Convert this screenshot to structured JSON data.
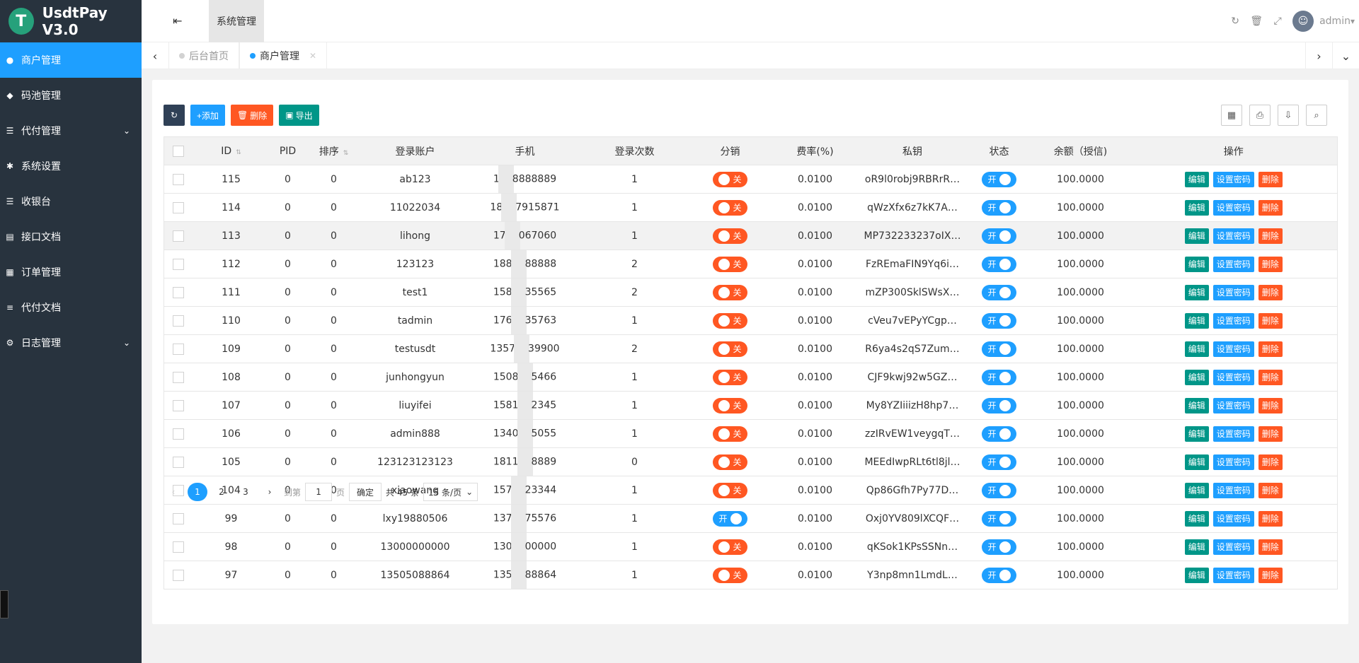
{
  "app": {
    "logo_glyph": "T",
    "title": "UsdtPay V3.0"
  },
  "sidebar": {
    "items": [
      {
        "label": "商户管理",
        "icon": "user-icon",
        "glyph": "●",
        "active": true
      },
      {
        "label": "码池管理",
        "icon": "android-icon",
        "glyph": "◆"
      },
      {
        "label": "代付管理",
        "icon": "list-icon",
        "glyph": "☰",
        "expandable": true
      },
      {
        "label": "系统设置",
        "icon": "asterisk-icon",
        "glyph": "✱"
      },
      {
        "label": "收银台",
        "icon": "list-icon",
        "glyph": "☰"
      },
      {
        "label": "接口文档",
        "icon": "book-icon",
        "glyph": "▤"
      },
      {
        "label": "订单管理",
        "icon": "calculator-icon",
        "glyph": "▦"
      },
      {
        "label": "代付文档",
        "icon": "align-icon",
        "glyph": "≡"
      },
      {
        "label": "日志管理",
        "icon": "gear-icon",
        "glyph": "⚙",
        "expandable": true
      }
    ]
  },
  "header": {
    "toggle_glyph": "⇤",
    "system_tab": "系统管理",
    "user": "admin"
  },
  "tabs": {
    "items": [
      {
        "label": "后台首页",
        "active": false
      },
      {
        "label": "商户管理",
        "active": true
      }
    ]
  },
  "toolbar": {
    "add": "+添加",
    "delete": "删除",
    "export": "导出"
  },
  "table": {
    "headers": [
      "ID",
      "PID",
      "排序",
      "登录账户",
      "手机",
      "登录次数",
      "分销",
      "费率(%)",
      "私钥",
      "状态",
      "余额（授信)",
      "操作"
    ],
    "switch_off": "关",
    "switch_on": "开",
    "ops": {
      "edit": "编辑",
      "set_pwd": "设置密码",
      "delete": "删除"
    },
    "rows": [
      {
        "id": "115",
        "pid": "0",
        "sort": "0",
        "account": "ab123",
        "phone_a": "1",
        "phone_b": "8888889",
        "logins": "1",
        "dist": "off",
        "rate": "0.0100",
        "key": "oR9l0robj9RBRrR…",
        "status": "on",
        "balance": "100.0000"
      },
      {
        "id": "114",
        "pid": "0",
        "sort": "0",
        "account": "11022034",
        "phone_a": "18",
        "phone_b": "7915871",
        "logins": "1",
        "dist": "off",
        "rate": "0.0100",
        "key": "qWzXfx6z7kK7A…",
        "status": "on",
        "balance": "100.0000"
      },
      {
        "id": "113",
        "pid": "0",
        "sort": "0",
        "account": "lihong",
        "phone_a": "17",
        "phone_b": "067060",
        "logins": "1",
        "dist": "off",
        "rate": "0.0100",
        "key": "MP732233237oIX…",
        "status": "on",
        "balance": "100.0000"
      },
      {
        "id": "112",
        "pid": "0",
        "sort": "0",
        "account": "123123",
        "phone_a": "188",
        "phone_b": "88888",
        "logins": "2",
        "dist": "off",
        "rate": "0.0100",
        "key": "FzREmaFIN9Yq6i…",
        "status": "on",
        "balance": "100.0000"
      },
      {
        "id": "111",
        "pid": "0",
        "sort": "0",
        "account": "test1",
        "phone_a": "158",
        "phone_b": "35565",
        "logins": "2",
        "dist": "off",
        "rate": "0.0100",
        "key": "mZP300SklSWsX…",
        "status": "on",
        "balance": "100.0000"
      },
      {
        "id": "110",
        "pid": "0",
        "sort": "0",
        "account": "tadmin",
        "phone_a": "176",
        "phone_b": "35763",
        "logins": "1",
        "dist": "off",
        "rate": "0.0100",
        "key": "cVeu7vEPyYCgp…",
        "status": "on",
        "balance": "100.0000"
      },
      {
        "id": "109",
        "pid": "0",
        "sort": "0",
        "account": "testusdt",
        "phone_a": "1357",
        "phone_b": "39900",
        "logins": "2",
        "dist": "off",
        "rate": "0.0100",
        "key": "R6ya4s2qS7Zum…",
        "status": "on",
        "balance": "100.0000"
      },
      {
        "id": "108",
        "pid": "0",
        "sort": "0",
        "account": "junhongyun",
        "phone_a": "1508",
        "phone_b": "5466",
        "logins": "1",
        "dist": "off",
        "rate": "0.0100",
        "key": "CJF9kwj92w5GZ…",
        "status": "on",
        "balance": "100.0000"
      },
      {
        "id": "107",
        "pid": "0",
        "sort": "0",
        "account": "liuyifei",
        "phone_a": "1581",
        "phone_b": "2345",
        "logins": "1",
        "dist": "off",
        "rate": "0.0100",
        "key": "My8YZIiiizH8hp7…",
        "status": "on",
        "balance": "100.0000"
      },
      {
        "id": "106",
        "pid": "0",
        "sort": "0",
        "account": "admin888",
        "phone_a": "1340",
        "phone_b": "5055",
        "logins": "1",
        "dist": "off",
        "rate": "0.0100",
        "key": "zzIRvEW1veygqT…",
        "status": "on",
        "balance": "100.0000"
      },
      {
        "id": "105",
        "pid": "0",
        "sort": "0",
        "account": "123123123123",
        "phone_a": "1811",
        "phone_b": "8889",
        "logins": "0",
        "dist": "off",
        "rate": "0.0100",
        "key": "MEEdIwpRLt6tl8jl…",
        "status": "on",
        "balance": "100.0000"
      },
      {
        "id": "104",
        "pid": "0",
        "sort": "0",
        "account": "xiaowang",
        "phone_a": "157",
        "phone_b": "23344",
        "logins": "1",
        "dist": "off",
        "rate": "0.0100",
        "key": "Qp86Gfh7Py77D…",
        "status": "on",
        "balance": "100.0000"
      },
      {
        "id": "99",
        "pid": "0",
        "sort": "0",
        "account": "lxy19880506",
        "phone_a": "137",
        "phone_b": "75576",
        "logins": "1",
        "dist": "on",
        "rate": "0.0100",
        "key": "Oxj0YV809lXCQF…",
        "status": "on",
        "balance": "100.0000"
      },
      {
        "id": "98",
        "pid": "0",
        "sort": "0",
        "account": "13000000000",
        "phone_a": "130",
        "phone_b": "00000",
        "logins": "1",
        "dist": "off",
        "rate": "0.0100",
        "key": "qKSok1KPsSSNn…",
        "status": "on",
        "balance": "100.0000"
      },
      {
        "id": "97",
        "pid": "0",
        "sort": "0",
        "account": "13505088864",
        "phone_a": "135",
        "phone_b": "88864",
        "logins": "1",
        "dist": "off",
        "rate": "0.0100",
        "key": "Y3np8mn1LmdL…",
        "status": "on",
        "balance": "100.0000"
      }
    ],
    "highlight_row": 2
  },
  "pager": {
    "pages": [
      "1",
      "2",
      "3"
    ],
    "current": "1",
    "goto_label": "到第",
    "goto_value": "1",
    "page_unit": "页",
    "confirm": "确定",
    "total": "共 45 条",
    "per_page": "15 条/页"
  }
}
